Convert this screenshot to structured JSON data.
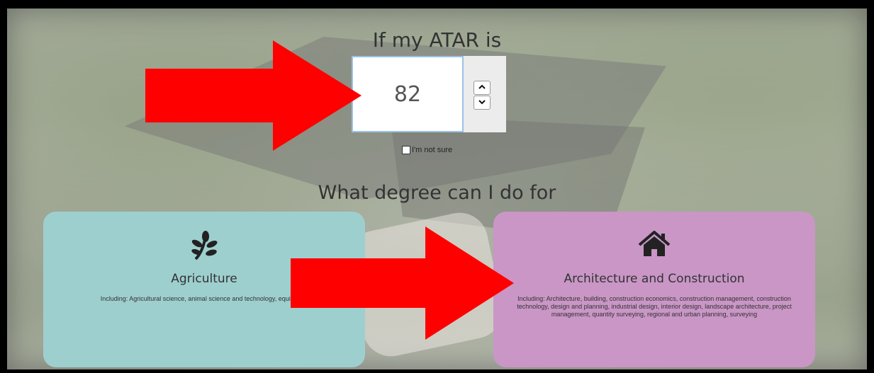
{
  "atar": {
    "heading": "If my ATAR is",
    "value": "82",
    "unsure_label": "I'm not sure"
  },
  "degree": {
    "heading": "What degree can I do for"
  },
  "cards": [
    {
      "title": "Agriculture",
      "description": "Including: Agricultural science, animal science and technology, equine, ve",
      "icon": "leaf-sprig-icon",
      "color": "#9ecfcf"
    },
    {
      "title": "Architecture and Construction",
      "description": "Including: Architecture, building, construction economics, construction management, construction technology, design and planning, industrial design, interior design, landscape architecture, project management, quantity surveying, regional and urban planning, surveying",
      "icon": "house-icon",
      "color": "#c996c6"
    }
  ],
  "annotations": {
    "arrow_color": "#ff0000"
  }
}
